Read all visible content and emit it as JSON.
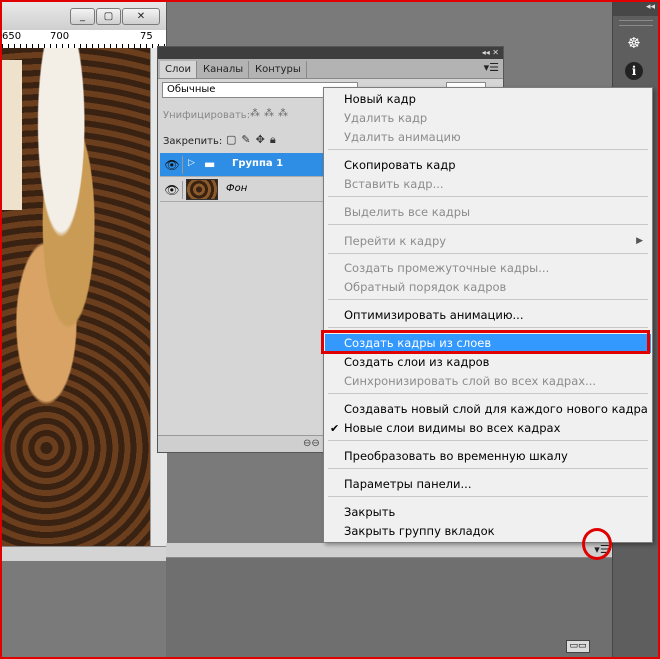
{
  "document_window": {
    "ruler_ticks": [
      "650",
      "700",
      "75"
    ],
    "buttons": [
      "_",
      "▢",
      "✕"
    ]
  },
  "layers_panel": {
    "tabs": [
      "Слои",
      "Каналы",
      "Контуры"
    ],
    "blend_mode": "Обычные",
    "unify_label": "Унифицировать:",
    "lock_label": "Закрепить:",
    "layers": [
      {
        "name": "Группа 1",
        "type": "group",
        "selected": true
      },
      {
        "name": "Фон",
        "type": "image",
        "selected": false
      }
    ]
  },
  "context_menu": {
    "items": [
      {
        "label": "Новый кадр",
        "enabled": true
      },
      {
        "label": "Удалить кадр",
        "enabled": false
      },
      {
        "label": "Удалить анимацию",
        "enabled": false
      },
      {
        "label": "Скопировать кадр",
        "enabled": true
      },
      {
        "label": "Вставить кадр...",
        "enabled": false
      },
      {
        "label": "Выделить все кадры",
        "enabled": false
      },
      {
        "label": "Перейти к кадру",
        "enabled": false,
        "submenu": true
      },
      {
        "label": "Создать промежуточные кадры...",
        "enabled": false
      },
      {
        "label": "Обратный порядок кадров",
        "enabled": false
      },
      {
        "label": "Оптимизировать анимацию...",
        "enabled": true
      },
      {
        "label": "Создать кадры из слоев",
        "enabled": true,
        "highlighted": true
      },
      {
        "label": "Создать слои из кадров",
        "enabled": true
      },
      {
        "label": "Синхронизировать слой во всех кадрах...",
        "enabled": false
      },
      {
        "label": "Создавать новый слой для каждого нового кадра",
        "enabled": true
      },
      {
        "label": "Новые слои видимы во всех кадрах",
        "enabled": true,
        "checked": true
      },
      {
        "label": "Преобразовать во временную шкалу",
        "enabled": true
      },
      {
        "label": "Параметры панели...",
        "enabled": true
      },
      {
        "label": "Закрыть",
        "enabled": true
      },
      {
        "label": "Закрыть группу вкладок",
        "enabled": true
      }
    ]
  },
  "right_strip": {
    "icons": [
      "ship-wheel-icon",
      "info-icon"
    ]
  },
  "colors": {
    "highlight": "#3399ff",
    "selected_layer": "#2e8de4",
    "annotation_red": "#e00000"
  }
}
